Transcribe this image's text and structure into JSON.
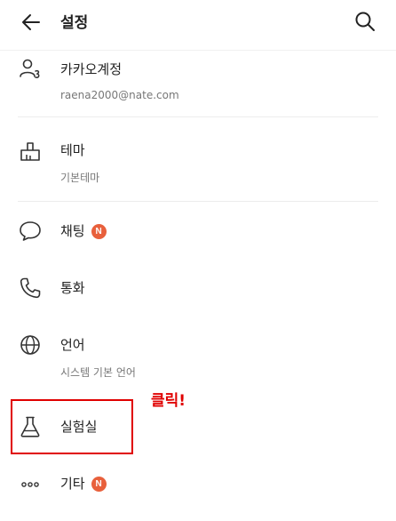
{
  "header": {
    "title": "설정"
  },
  "items": {
    "account": {
      "label": "카카오계정",
      "sub": "raena2000@nate.com"
    },
    "theme": {
      "label": "테마",
      "sub": "기본테마"
    },
    "chat": {
      "label": "채팅",
      "badge": "N"
    },
    "call": {
      "label": "통화"
    },
    "language": {
      "label": "언어",
      "sub": "시스템 기본 언어"
    },
    "lab": {
      "label": "실험실"
    },
    "etc": {
      "label": "기타",
      "badge": "N"
    }
  },
  "annotation": {
    "text": "클릭!",
    "color": "#e00000"
  },
  "colors": {
    "badge": "#e8603c",
    "text": "#222222",
    "subtext": "#777777"
  },
  "icons": [
    "back-arrow-icon",
    "search-icon",
    "person-icon",
    "brush-icon",
    "chat-bubble-icon",
    "phone-icon",
    "globe-icon",
    "flask-icon",
    "more-dots-icon"
  ]
}
